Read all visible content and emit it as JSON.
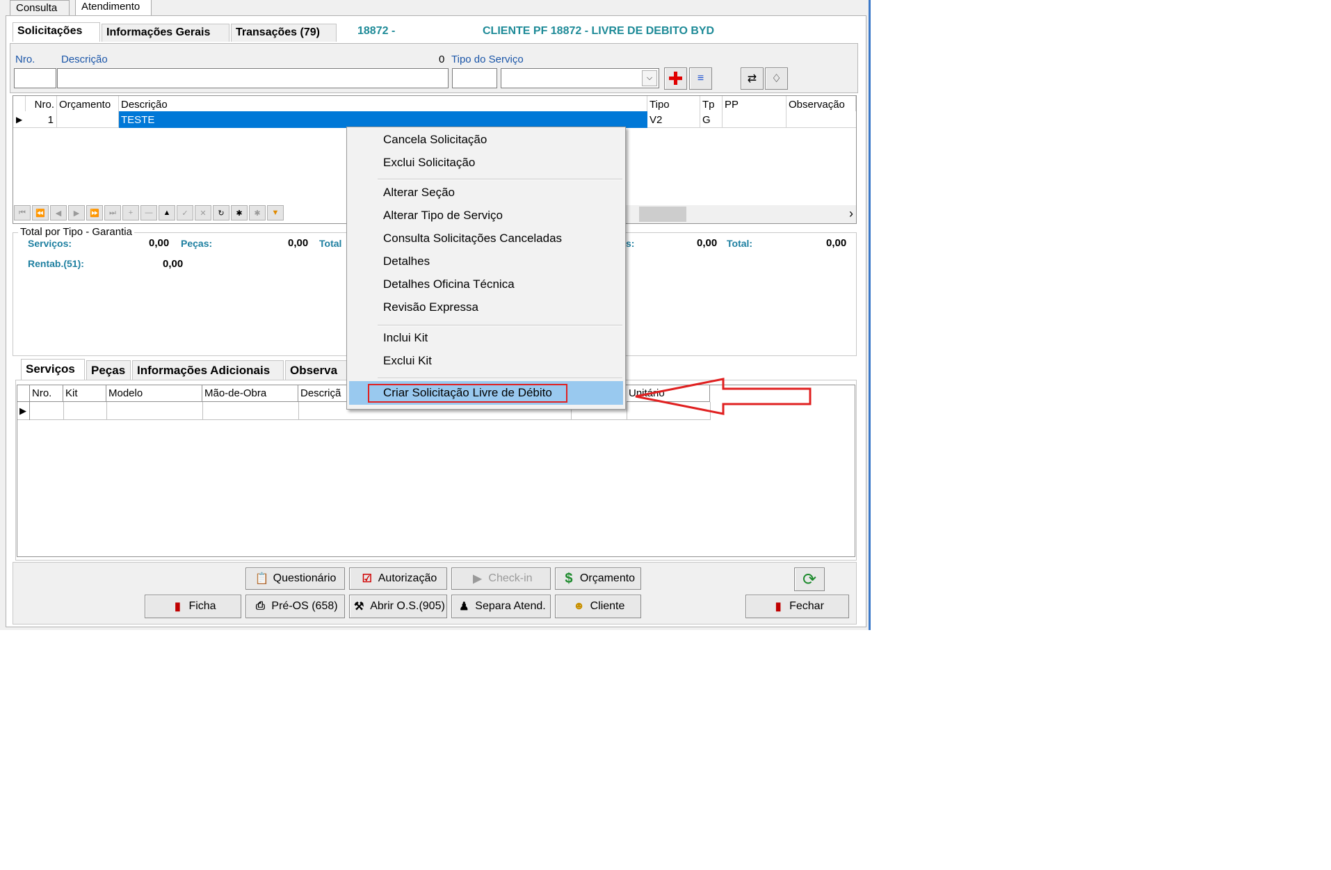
{
  "top_tabs": [
    "Consulta",
    "Atendimento"
  ],
  "sub_tabs": [
    "Solicitações",
    "Informações Gerais",
    "Transações (79)"
  ],
  "header": {
    "client_no": "18872 -",
    "client_name": "CLIENTE PF 18872 - LIVRE DE DEBITO BYD"
  },
  "form": {
    "nro_label": "Nro.",
    "descricao_label": "Descrição",
    "zero": "0",
    "tipo_servico_label": "Tipo do Serviço"
  },
  "grid": {
    "columns": [
      "Nro.",
      "Orçamento",
      "Descrição",
      "Tipo",
      "Tp",
      "PP",
      "Observação"
    ],
    "rows": [
      {
        "nro": "1",
        "orcamento": "",
        "descricao": "TESTE",
        "tipo": "V2",
        "tp": "G",
        "pp": "",
        "observacao": ""
      }
    ]
  },
  "totals": {
    "legend": "Total por Tipo - Garantia",
    "servicos_label": "Serviços:",
    "servicos_value": "0,00",
    "pecas_label": "Peças:",
    "pecas_value": "0,00",
    "total_label_cut": "Total",
    "s_cut": "s:",
    "right_value": "0,00",
    "total_label": "Total:",
    "total_value": "0,00",
    "rentab_label": "Rentab.(51):",
    "rentab_value": "0,00"
  },
  "bottom_tabs": [
    "Serviços",
    "Peças",
    "Informações Adicionais",
    "Observa"
  ],
  "bottom_grid": {
    "columns": [
      "Nro.",
      "Kit",
      "Modelo",
      "Mão-de-Obra",
      "Descriçã",
      "Unitário"
    ]
  },
  "context_menu": {
    "items": [
      "Cancela Solicitação",
      "Exclui Solicitação",
      "Alterar Seção",
      "Alterar Tipo de Serviço",
      "Consulta Solicitações Canceladas",
      "Detalhes",
      "Detalhes Oficina Técnica",
      "Revisão Expressa",
      "Inclui Kit",
      "Exclui Kit",
      "Criar Solicitação Livre de Débito"
    ]
  },
  "buttons": {
    "questionario": "Questionário",
    "autorizacao": "Autorização",
    "checkin": "Check-in",
    "orcamento": "Orçamento",
    "ficha": "Ficha",
    "preos": "Pré-OS (658)",
    "abrir_os": "Abrir O.S.(905)",
    "separa": "Separa Atend.",
    "cliente": "Cliente",
    "fechar": "Fechar"
  },
  "colors": {
    "selection": "#0078d7",
    "highlight": "#99c9ef",
    "annotation": "#e02020",
    "teal": "#1d8a97"
  }
}
